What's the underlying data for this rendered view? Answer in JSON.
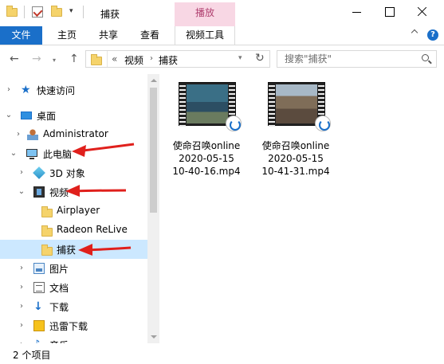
{
  "window": {
    "title": "捕获",
    "contextual_tab": "播放"
  },
  "ribbon": {
    "tabs": [
      "文件",
      "主页",
      "共享",
      "查看",
      "视频工具"
    ]
  },
  "address": {
    "more": "«",
    "path": [
      "视频",
      "捕获"
    ],
    "separator": "›"
  },
  "search": {
    "placeholder": "搜索\"捕获\""
  },
  "tree": {
    "items": [
      {
        "label": "快速访问",
        "icon": "star-icon"
      },
      {
        "label": "桌面",
        "icon": "desktop-icon"
      },
      {
        "label": "Administrator",
        "icon": "user-icon"
      },
      {
        "label": "此电脑",
        "icon": "computer-icon"
      },
      {
        "label": "3D 对象",
        "icon": "cube-icon"
      },
      {
        "label": "视频",
        "icon": "video-icon"
      },
      {
        "label": "Airplayer",
        "icon": "folder-icon"
      },
      {
        "label": "Radeon ReLive",
        "icon": "folder-icon"
      },
      {
        "label": "捕获",
        "icon": "folder-icon",
        "selected": true
      },
      {
        "label": "图片",
        "icon": "pictures-icon"
      },
      {
        "label": "文档",
        "icon": "documents-icon"
      },
      {
        "label": "下载",
        "icon": "download-icon"
      },
      {
        "label": "迅雷下载",
        "icon": "folder-icon"
      },
      {
        "label": "音乐",
        "icon": "music-icon"
      }
    ]
  },
  "files": [
    {
      "line1": "使命召唤online",
      "line2": "2020-05-15",
      "line3": "10-40-16.mp4"
    },
    {
      "line1": "使命召唤online",
      "line2": "2020-05-15",
      "line3": "10-41-31.mp4"
    }
  ],
  "status": {
    "count": "2 个项目"
  },
  "colors": {
    "accent": "#1a6fc9",
    "selected_bg": "#cce8ff",
    "contextual_tab": "#f8d7e4",
    "annotation_arrow": "#e0201c"
  }
}
